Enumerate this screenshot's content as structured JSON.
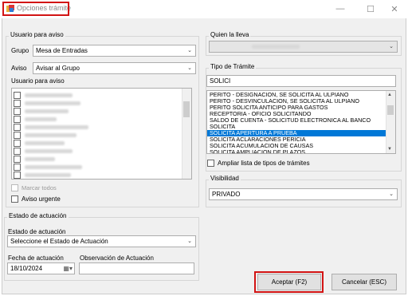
{
  "window": {
    "title": "Opciones trámite",
    "minimize": "—",
    "maximize": "☐",
    "close": "✕"
  },
  "usuario_group": {
    "label": "Usuario para aviso",
    "grupo_label": "Grupo",
    "grupo_value": "Mesa de Entradas",
    "aviso_label": "Aviso",
    "aviso_value": "Avisar al Grupo",
    "list_label": "Usuario para aviso",
    "marcar_todos": "Marcar todos",
    "aviso_urgente": "Aviso urgente"
  },
  "quien_lleva": {
    "label": "Quien la lleva"
  },
  "tipo_tramite": {
    "label": "Tipo de Trámite",
    "search_value": "SOLICI",
    "items": [
      "PERITO - DESIGNACION, SE SOLICITA AL ULPIANO",
      "PERITO - DESVINCULACION, SE SOLICITA AL ULPIANO",
      "PERITO SOLICITA ANTICIPO PARA GASTOS",
      "RECEPTORIA - OFICIO SOLICITANDO",
      "SALDO DE CUENTA - SOLICITUD ELECTRONICA AL BANCO",
      "SOLICITA",
      "SOLICITA APERTURA A PRUEBA",
      "SOLICITA ACLARACIONES PERICIA",
      "SOLICITA ACUMULACION DE CAUSAS",
      "SOLICITA AMPLIACION DE PLAZOS"
    ],
    "selected_index": 6,
    "ampliar": "Ampliar lista de tipos de trámites"
  },
  "visibilidad": {
    "label": "Visibilidad",
    "value": "PRIVADO"
  },
  "estado": {
    "group_label": "Estado de actuación",
    "field_label": "Estado de actuación",
    "value": "Seleccione el Estado de Actuación",
    "fecha_label": "Fecha de actuación",
    "fecha_value": "18/10/2024",
    "obs_label": "Observación de Actuación",
    "obs_value": ""
  },
  "buttons": {
    "aceptar": "Aceptar (F2)",
    "cancelar": "Cancelar (ESC)"
  }
}
